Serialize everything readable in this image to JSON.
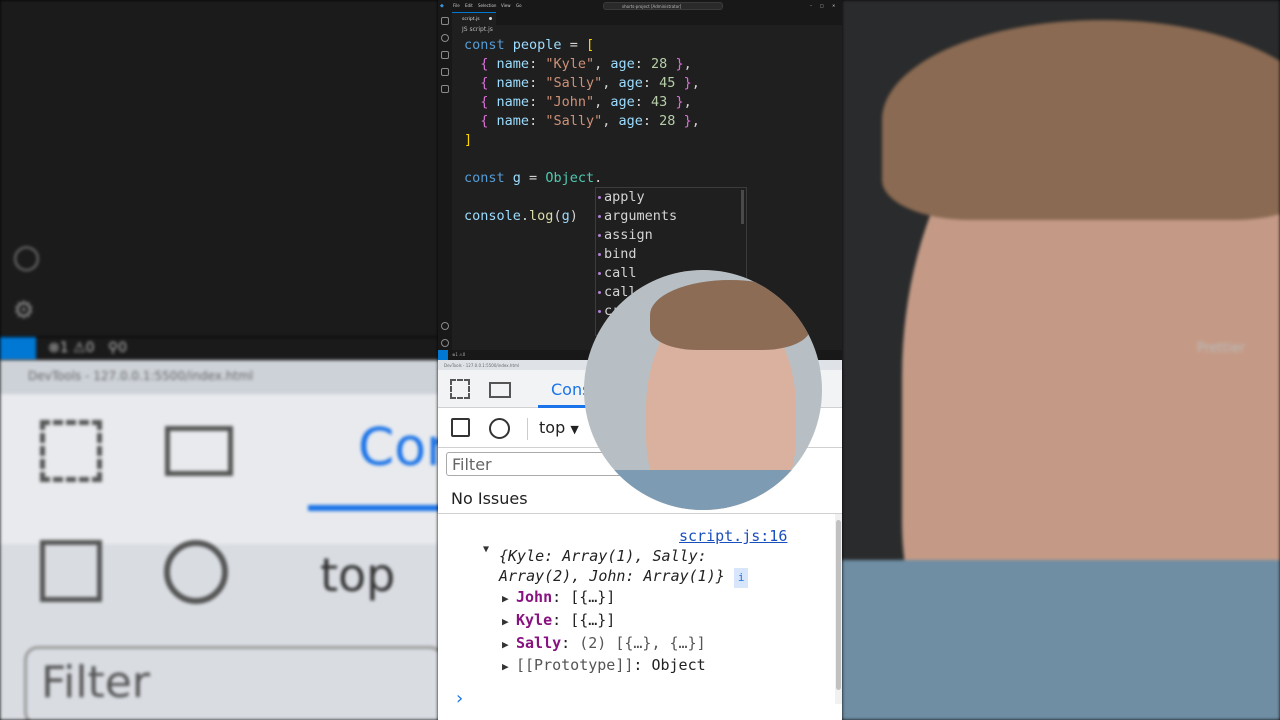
{
  "editor": {
    "title": "shorts-project [Administrator]",
    "tab": "script.js",
    "breadcrumb": "JS script.js",
    "menu": [
      "File",
      "Edit",
      "Selection",
      "View",
      "Go"
    ],
    "code": {
      "l1": {
        "kw": "const",
        "name": "people",
        "op": " = ",
        "br": "["
      },
      "rows": [
        {
          "name": "\"Kyle\"",
          "age": "28"
        },
        {
          "name": "\"Sally\"",
          "age": "45"
        },
        {
          "name": "\"John\"",
          "age": "43"
        },
        {
          "name": "\"Sally\"",
          "age": "28"
        }
      ],
      "close": "]",
      "l7": {
        "kw": "const",
        "name": "g",
        "obj": "Object",
        "dot": "."
      },
      "l9": {
        "obj": "console",
        "fn": "log",
        "arg": "g"
      }
    },
    "suggestions": [
      "apply",
      "arguments",
      "assign",
      "bind",
      "call",
      "caller",
      "create"
    ],
    "status": {
      "errors": "1",
      "warnings": "0",
      "ports": "0",
      "prettier": "Prettier"
    }
  },
  "devtools": {
    "title": "DevTools - 127.0.0.1:5500/index.html",
    "console_tab": "Console",
    "context": "top",
    "filter_placeholder": "Filter",
    "issues": "No Issues",
    "log_source": "script.js:16",
    "summary": "{Kyle: Array(1), Sally: Array(2), John: Array(1)}",
    "entries": [
      {
        "key": "John",
        "value": "[{…}]"
      },
      {
        "key": "Kyle",
        "value": "[{…}]"
      },
      {
        "key": "Sally",
        "value": "(2) [{…}, {…}]"
      },
      {
        "key": "[[Prototype]]",
        "value": "Object"
      }
    ],
    "prompt": "›"
  },
  "colors": {
    "editor_bg": "#1f1f1f",
    "devtools_bg": "#ffffff",
    "accent": "#1a73e8",
    "prop": "#881280"
  }
}
